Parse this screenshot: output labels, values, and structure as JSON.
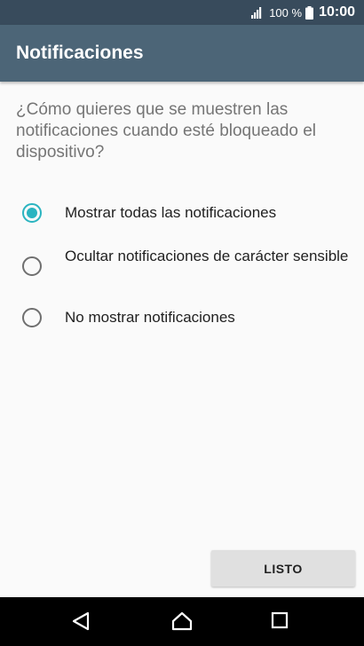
{
  "status_bar": {
    "battery_percent": "100 %",
    "time": "10:00",
    "signal_icon": "cellular-signal-icon",
    "battery_icon": "battery-full-icon"
  },
  "app_bar": {
    "title": "Notificaciones"
  },
  "question": "¿Cómo quieres que se muestren las notificaciones cuando esté bloqueado el dispositivo?",
  "options": [
    {
      "label": "Mostrar todas las notificaciones",
      "selected": true
    },
    {
      "label": "Ocultar notificaciones de carácter sensible",
      "selected": false
    },
    {
      "label": "No mostrar notificaciones",
      "selected": false
    }
  ],
  "done_button": {
    "label": "LISTO"
  },
  "nav_bar": {
    "back_icon": "back-triangle-icon",
    "home_icon": "home-icon",
    "recents_icon": "recents-square-icon"
  },
  "colors": {
    "app_bar": "#4c6577",
    "status_bar": "#384b5c",
    "accent": "#2ab4c0",
    "background": "#fafafa"
  }
}
